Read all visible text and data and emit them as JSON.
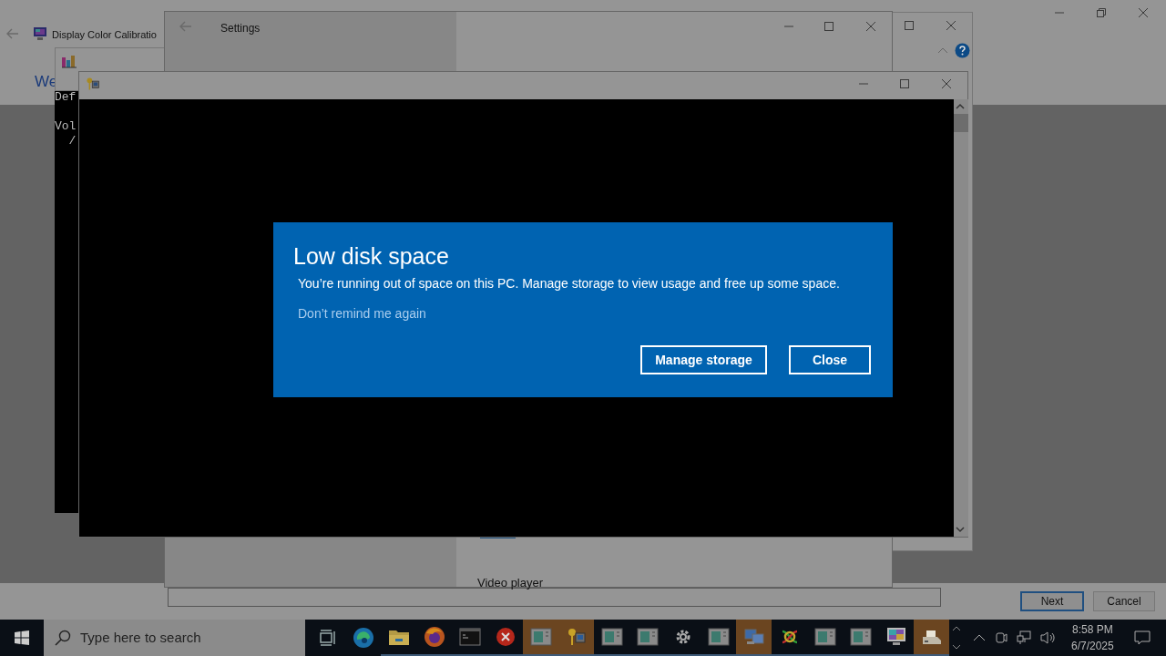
{
  "calibration_window": {
    "title": "Display Color Calibratio",
    "heading": "We",
    "buttons": [
      {
        "label": "Next",
        "selected": true
      },
      {
        "label": "Cancel",
        "selected": false
      }
    ]
  },
  "console_back": {
    "lines": [
      "Def",
      "Vol",
      "  /"
    ]
  },
  "settings_window": {
    "title": "Settings",
    "item": "Video player"
  },
  "dialog": {
    "title": "Low disk space",
    "message": "You’re running out of space on this PC. Manage storage to view usage and free up some space.",
    "link": "Don’t remind me again",
    "buttons": [
      "Manage storage",
      "Close"
    ]
  },
  "taskbar": {
    "search_placeholder": "Type here to search",
    "apps": [
      {
        "kind": "taskview",
        "highlighted": false,
        "running": false
      },
      {
        "kind": "edge",
        "highlighted": false,
        "running": false
      },
      {
        "kind": "folder",
        "highlighted": false,
        "running": true
      },
      {
        "kind": "firefox",
        "highlighted": false,
        "running": true
      },
      {
        "kind": "terminal",
        "highlighted": false,
        "running": true
      },
      {
        "kind": "error",
        "highlighted": false,
        "running": true
      },
      {
        "kind": "window",
        "highlighted": true,
        "running": true
      },
      {
        "kind": "keys",
        "highlighted": true,
        "running": true
      },
      {
        "kind": "window",
        "highlighted": false,
        "running": true
      },
      {
        "kind": "window",
        "highlighted": false,
        "running": true
      },
      {
        "kind": "gear",
        "highlighted": false,
        "running": true
      },
      {
        "kind": "window",
        "highlighted": false,
        "running": true
      },
      {
        "kind": "network",
        "highlighted": true,
        "running": true
      },
      {
        "kind": "colors",
        "highlighted": false,
        "running": true
      },
      {
        "kind": "window",
        "highlighted": false,
        "running": true
      },
      {
        "kind": "window",
        "highlighted": false,
        "running": true
      },
      {
        "kind": "monitor",
        "highlighted": false,
        "running": true
      },
      {
        "kind": "printer",
        "highlighted": true,
        "running": true
      }
    ],
    "time": "8:58 PM",
    "date": "6/7/2025"
  }
}
